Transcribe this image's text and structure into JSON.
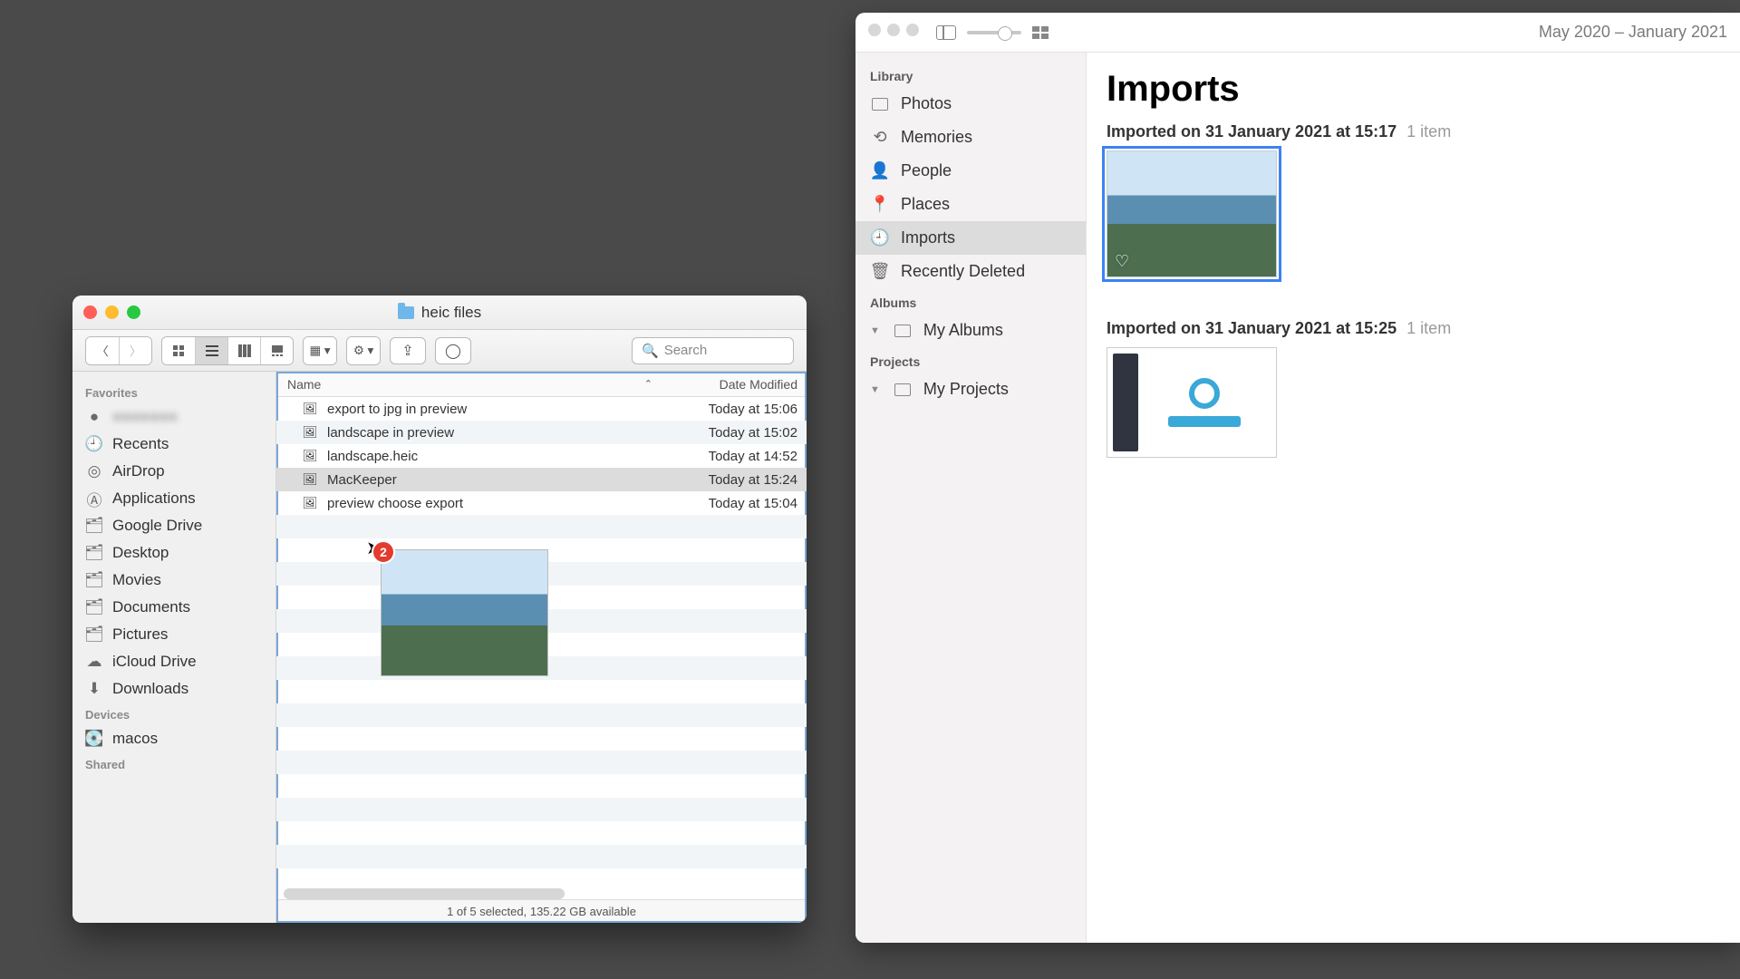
{
  "finder": {
    "title": "heic files",
    "search_placeholder": "Search",
    "sidebar": {
      "sections": [
        {
          "title": "Favorites",
          "items": [
            {
              "label": "●●●●●●●",
              "blur": true
            },
            {
              "label": "Recents"
            },
            {
              "label": "AirDrop"
            },
            {
              "label": "Applications"
            },
            {
              "label": "Google Drive"
            },
            {
              "label": "Desktop"
            },
            {
              "label": "Movies"
            },
            {
              "label": "Documents"
            },
            {
              "label": "Pictures"
            },
            {
              "label": "iCloud Drive"
            },
            {
              "label": "Downloads"
            }
          ]
        },
        {
          "title": "Devices",
          "items": [
            {
              "label": "macos"
            }
          ]
        },
        {
          "title": "Shared",
          "items": []
        }
      ]
    },
    "columns": {
      "name": "Name",
      "date": "Date Modified"
    },
    "files": [
      {
        "name": "export to jpg in preview",
        "date": "Today at 15:06"
      },
      {
        "name": "landscape in preview",
        "date": "Today at 15:02"
      },
      {
        "name": "landscape.heic",
        "date": "Today at 14:52"
      },
      {
        "name": "MacKeeper",
        "date": "Today at 15:24",
        "selected": true
      },
      {
        "name": "preview choose export",
        "date": "Today at 15:04"
      }
    ],
    "drag_badge": "2",
    "status": "1 of 5 selected, 135.22 GB available"
  },
  "photos": {
    "date_range": "May 2020 – January 2021",
    "sidebar": {
      "library_title": "Library",
      "library_items": [
        "Photos",
        "Memories",
        "People",
        "Places",
        "Imports",
        "Recently Deleted"
      ],
      "library_selected": "Imports",
      "albums_title": "Albums",
      "albums_items": [
        "My Albums"
      ],
      "projects_title": "Projects",
      "projects_items": [
        "My Projects"
      ]
    },
    "main": {
      "title": "Imports",
      "groups": [
        {
          "heading": "Imported on 31 January 2021 at 15:17",
          "meta": "1 item",
          "thumb": "landscape",
          "selected": true
        },
        {
          "heading": "Imported on 31 January 2021 at 15:25",
          "meta": "1 item",
          "thumb": "app"
        }
      ]
    }
  }
}
